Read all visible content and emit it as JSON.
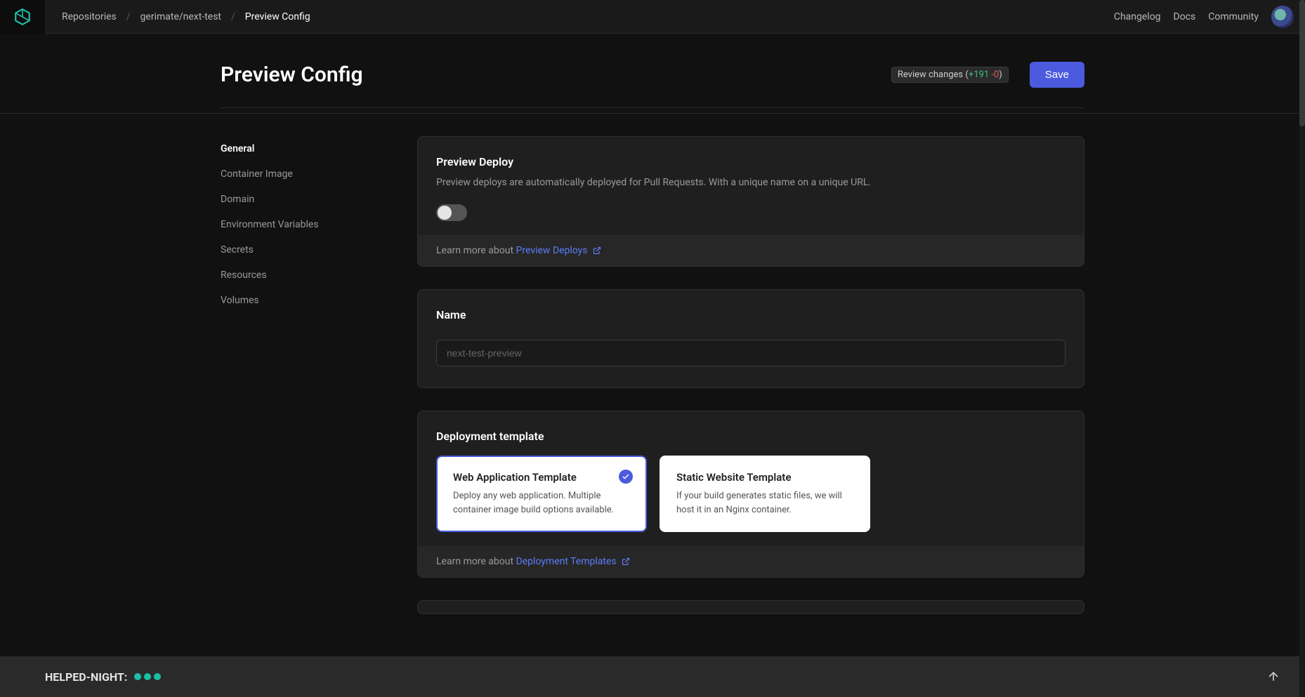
{
  "nav": {
    "links": {
      "repositories": "Repositories",
      "repo": "gerimate/next-test",
      "current": "Preview Config",
      "changelog": "Changelog",
      "docs": "Docs",
      "community": "Community"
    }
  },
  "header": {
    "title": "Preview Config",
    "review_label": "Review changes (",
    "review_plus": "+191",
    "review_minus": "-0",
    "review_close": ")",
    "save_label": "Save"
  },
  "sidebar": {
    "items": [
      {
        "label": "General",
        "active": true
      },
      {
        "label": "Container Image",
        "active": false
      },
      {
        "label": "Domain",
        "active": false
      },
      {
        "label": "Environment Variables",
        "active": false
      },
      {
        "label": "Secrets",
        "active": false
      },
      {
        "label": "Resources",
        "active": false
      },
      {
        "label": "Volumes",
        "active": false
      }
    ]
  },
  "cards": {
    "preview_deploy": {
      "title": "Preview Deploy",
      "desc": "Preview deploys are automatically deployed for Pull Requests. With a unique name on a unique URL.",
      "toggle_on": false,
      "footer_prefix": "Learn more about ",
      "footer_link": "Preview Deploys"
    },
    "name": {
      "title": "Name",
      "placeholder": "next-test-preview",
      "value": ""
    },
    "templates": {
      "title": "Deployment template",
      "options": [
        {
          "title": "Web Application Template",
          "desc": "Deploy any web application. Multiple container image build options available.",
          "selected": true
        },
        {
          "title": "Static Website Template",
          "desc": "If your build generates static files, we will host it in an Nginx container.",
          "selected": false
        }
      ],
      "footer_prefix": "Learn more about ",
      "footer_link": "Deployment Templates"
    }
  },
  "footer": {
    "label": "HELPED-NIGHT:"
  }
}
